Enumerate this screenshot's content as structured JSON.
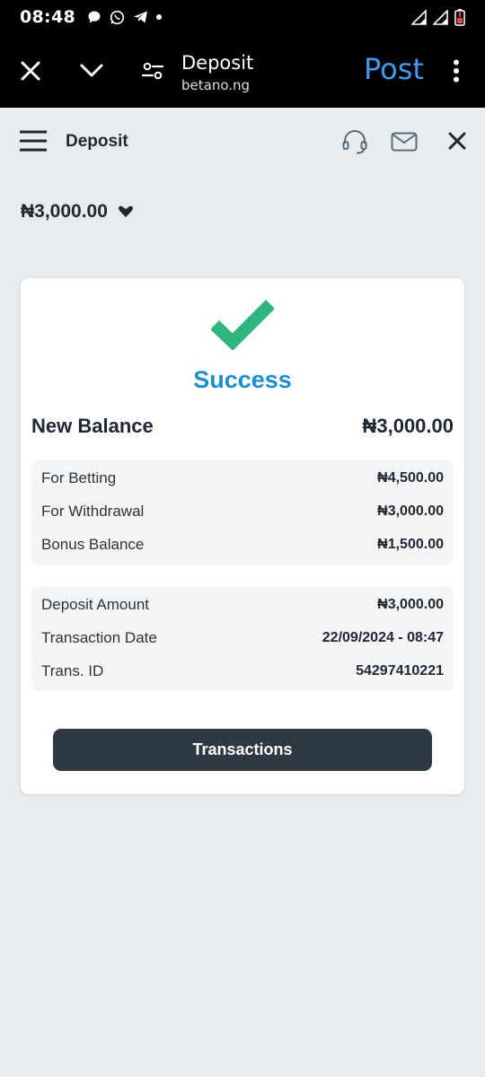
{
  "status_bar": {
    "time": "08:48"
  },
  "browser": {
    "title": "Deposit",
    "url": "betano.ng",
    "post_label": "Post",
    "accent_color": "#3d9cf5"
  },
  "header": {
    "title": "Deposit"
  },
  "balance": {
    "amount": "₦3,000.00"
  },
  "card": {
    "status_title": "Success",
    "success_color": "#1a8fd0",
    "check_color": "#2fb67e",
    "new_balance_label": "New Balance",
    "new_balance_value": "₦3,000.00",
    "balances": [
      {
        "label": "For Betting",
        "value": "₦4,500.00"
      },
      {
        "label": "For Withdrawal",
        "value": "₦3,000.00"
      },
      {
        "label": "Bonus Balance",
        "value": "₦1,500.00"
      }
    ],
    "details": [
      {
        "label": "Deposit Amount",
        "value": "₦3,000.00"
      },
      {
        "label": "Transaction Date",
        "value": "22/09/2024 - 08:47"
      },
      {
        "label": "Trans. ID",
        "value": "54297410221"
      }
    ],
    "button_label": "Transactions"
  }
}
